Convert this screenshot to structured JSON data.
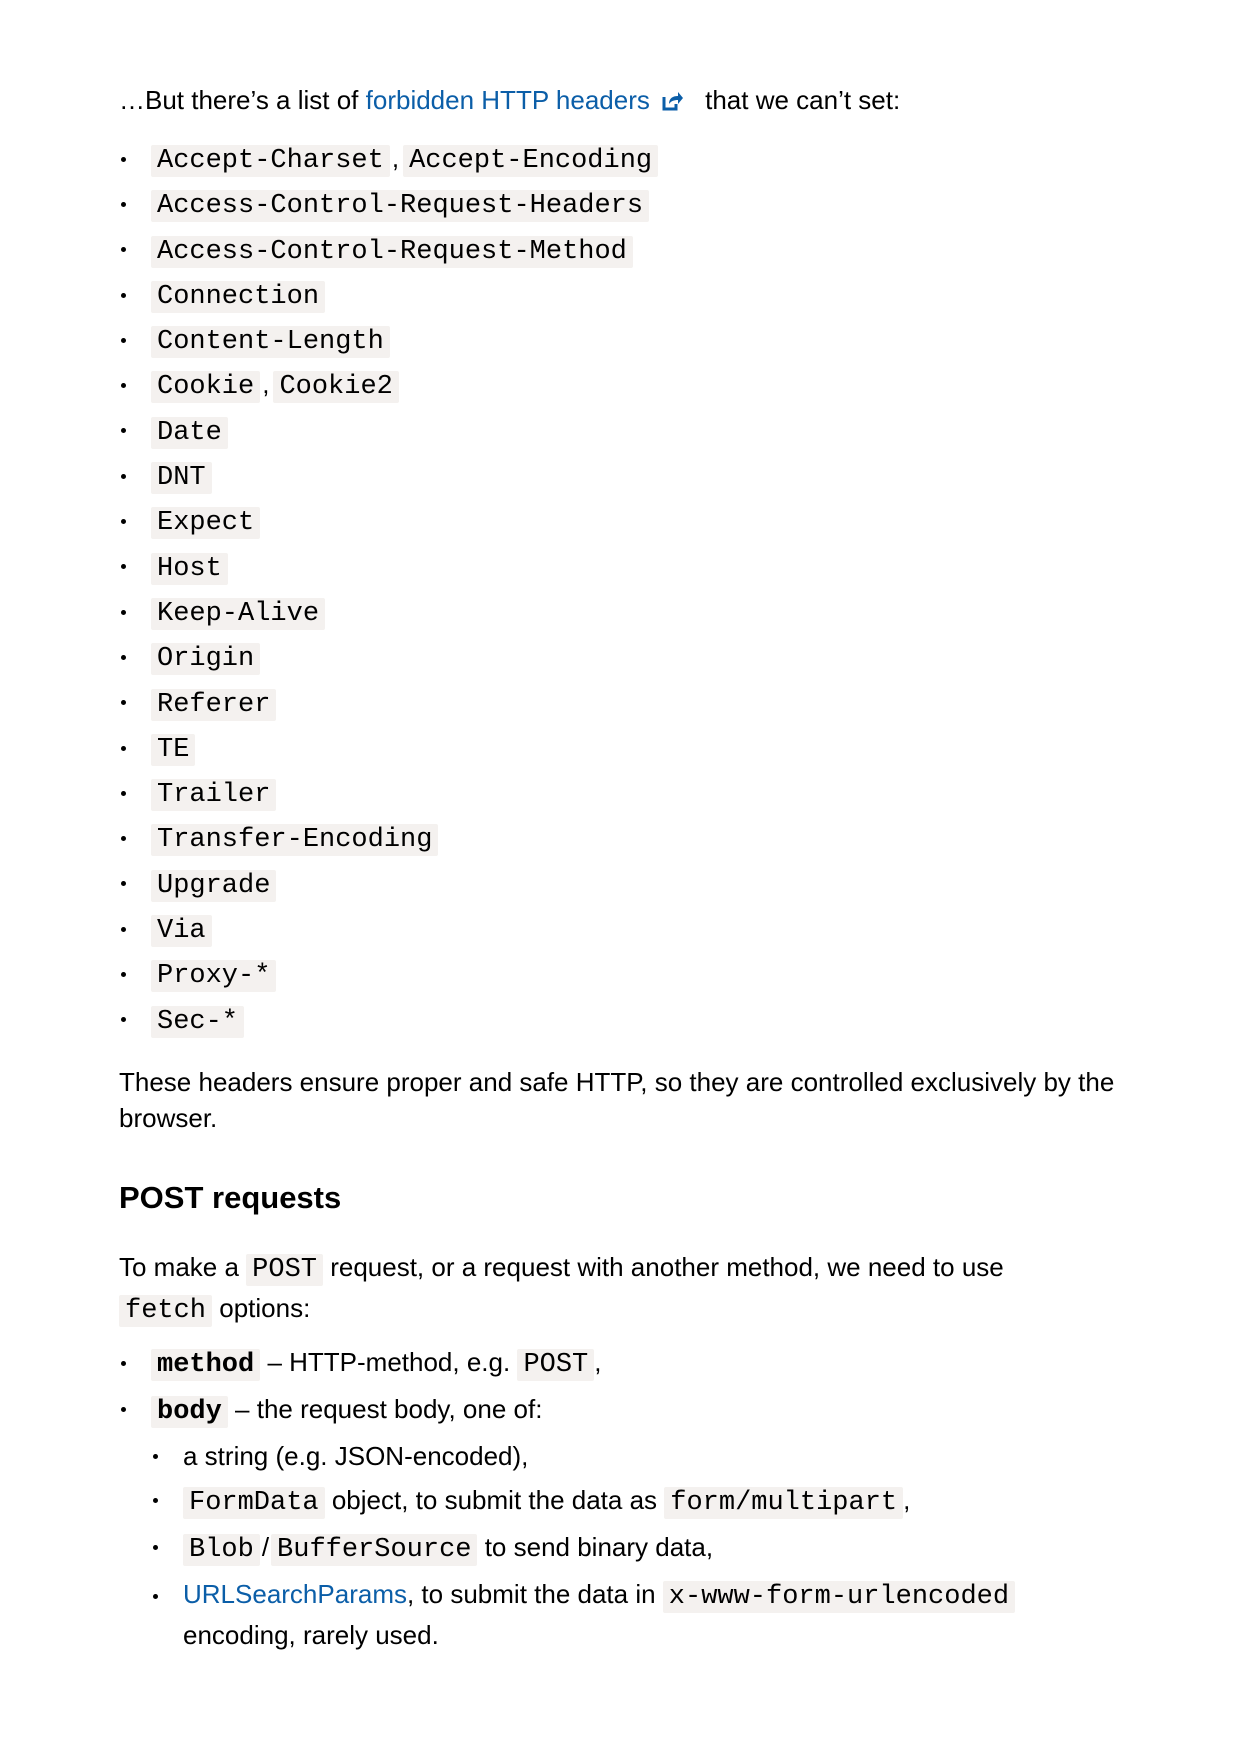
{
  "intro": {
    "before_link": "…But there’s a list of ",
    "link_text": "forbidden HTTP headers",
    "after_link": " that we can’t set:"
  },
  "forbidden_headers": [
    [
      "Accept-Charset",
      "Accept-Encoding"
    ],
    [
      "Access-Control-Request-Headers"
    ],
    [
      "Access-Control-Request-Method"
    ],
    [
      "Connection"
    ],
    [
      "Content-Length"
    ],
    [
      "Cookie",
      "Cookie2"
    ],
    [
      "Date"
    ],
    [
      "DNT"
    ],
    [
      "Expect"
    ],
    [
      "Host"
    ],
    [
      "Keep-Alive"
    ],
    [
      "Origin"
    ],
    [
      "Referer"
    ],
    [
      "TE"
    ],
    [
      "Trailer"
    ],
    [
      "Transfer-Encoding"
    ],
    [
      "Upgrade"
    ],
    [
      "Via"
    ],
    [
      "Proxy-*"
    ],
    [
      "Sec-*"
    ]
  ],
  "separator": ",",
  "after_list": "These headers ensure proper and safe HTTP, so they are controlled exclusively by the browser.",
  "section_title": "POST requests",
  "post_intro": {
    "t1": "To make a ",
    "code1": "POST",
    "t2": " request, or a request with another method, we need to use ",
    "code2": "fetch",
    "t3": " options:"
  },
  "options": {
    "method": {
      "code": "method",
      "t1": " – HTTP-method, e.g. ",
      "code2": "POST",
      "t2": ","
    },
    "body": {
      "code": "body",
      "text": " – the request body, one of:",
      "types": {
        "string": "a string (e.g. JSON-encoded),",
        "formdata": {
          "code": "FormData",
          "t1": " object, to submit the data as ",
          "code2": "form/multipart",
          "t2": ","
        },
        "blob": {
          "code1": "Blob",
          "slash": "/",
          "code2": "BufferSource",
          "text": " to send binary data,"
        },
        "urlsearch": {
          "link": "URLSearchParams",
          "t1": ", to submit the data in ",
          "code": "x-www-form-urlencoded",
          "t2": " encoding, rarely used."
        }
      }
    }
  },
  "colors": {
    "link": "#0b5ea8",
    "code_bg": "#f4f1ef",
    "text": "#000000"
  },
  "icons": {
    "external_link": "external-link-icon"
  }
}
